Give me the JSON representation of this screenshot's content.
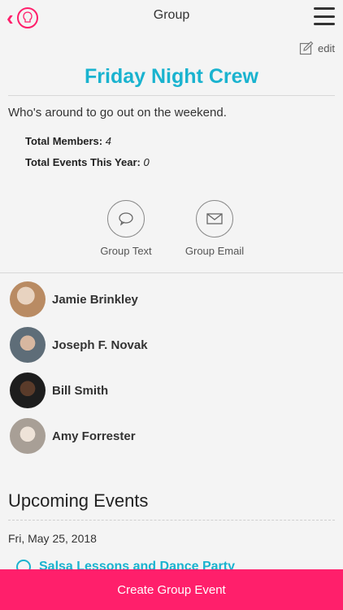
{
  "header": {
    "title": "Group"
  },
  "edit": {
    "label": "edit"
  },
  "group": {
    "name": "Friday Night Crew",
    "description": "Who's around to go out on the weekend.",
    "stats": [
      {
        "label": "Total Members:",
        "value": "4"
      },
      {
        "label": "Total Events This Year:",
        "value": "0"
      }
    ]
  },
  "actions": [
    {
      "label": "Group Text",
      "icon": "chat-bubble-icon"
    },
    {
      "label": "Group Email",
      "icon": "envelope-icon"
    }
  ],
  "members": [
    {
      "name": "Jamie Brinkley",
      "avatar_color": "#c9a27e"
    },
    {
      "name": "Joseph F. Novak",
      "avatar_color": "#6b7a85"
    },
    {
      "name": "Bill Smith",
      "avatar_color": "#2a2a2a"
    },
    {
      "name": "Amy Forrester",
      "avatar_color": "#b7b0a8"
    }
  ],
  "upcoming": {
    "title": "Upcoming Events",
    "date": "Fri, May 25, 2018",
    "first_event_title": "Salsa Lessons and Dance Party"
  },
  "cta": {
    "label": "Create Group Event"
  },
  "colors": {
    "accent": "#ff1f6b",
    "teal": "#1ab3cf"
  }
}
